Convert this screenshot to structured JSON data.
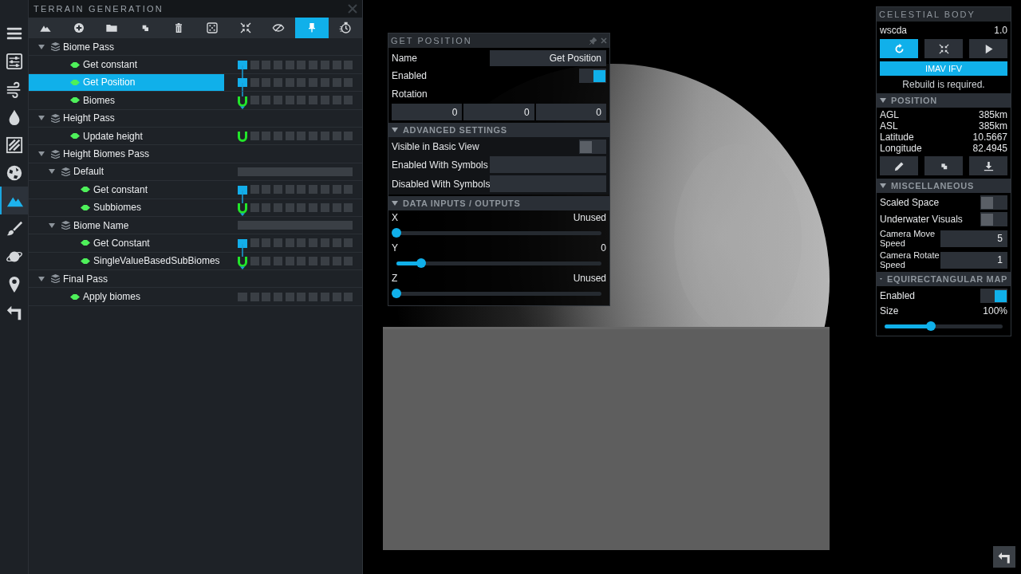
{
  "left_rail": [
    {
      "selected": false
    },
    {
      "selected": false
    },
    {
      "selected": false
    },
    {
      "selected": false
    },
    {
      "selected": false
    },
    {
      "selected": false
    },
    {
      "selected": true
    },
    {
      "selected": false
    },
    {
      "selected": false
    },
    {
      "selected": false
    },
    {
      "selected": false
    }
  ],
  "terrain_panel": {
    "title": "TERRAIN GENERATION",
    "toolbar": [
      {
        "selected": false
      },
      {
        "selected": false
      },
      {
        "selected": false
      },
      {
        "selected": false
      },
      {
        "selected": false
      },
      {
        "selected": false
      },
      {
        "selected": false
      },
      {
        "selected": false
      },
      {
        "selected": true
      },
      {
        "selected": false
      }
    ],
    "tree": [
      {
        "kind": "group",
        "label": "Biome Pass",
        "expanded": true,
        "lane_bar": false,
        "children": [
          {
            "kind": "node",
            "label": "Get constant",
            "selected": false,
            "output_port": true,
            "input_port": false,
            "link_in": false,
            "link_out": true
          },
          {
            "kind": "node",
            "label": "Get Position",
            "selected": true,
            "output_port": true,
            "input_port": false,
            "link_in": true,
            "link_out": true
          },
          {
            "kind": "node",
            "label": "Biomes",
            "selected": false,
            "output_port": false,
            "input_port": true,
            "link_in": true,
            "link_out": false
          }
        ]
      },
      {
        "kind": "group",
        "label": "Height Pass",
        "expanded": true,
        "lane_bar": false,
        "children": [
          {
            "kind": "node",
            "label": "Update height",
            "selected": false,
            "output_port": false,
            "input_port": true,
            "link_in": false,
            "link_out": false
          }
        ]
      },
      {
        "kind": "group",
        "label": "Height Biomes Pass",
        "expanded": true,
        "lane_bar": false,
        "children": [
          {
            "kind": "group",
            "label": "Default",
            "expanded": true,
            "lane_bar": true,
            "children": [
              {
                "kind": "node",
                "label": "Get constant",
                "selected": false,
                "output_port": true,
                "input_port": false,
                "link_in": false,
                "link_out": true
              },
              {
                "kind": "node",
                "label": "Subbiomes",
                "selected": false,
                "output_port": false,
                "input_port": true,
                "link_in": true,
                "link_out": false
              }
            ]
          },
          {
            "kind": "group",
            "label": "Biome Name",
            "expanded": true,
            "lane_bar": true,
            "children": [
              {
                "kind": "node",
                "label": "Get Constant",
                "selected": false,
                "output_port": true,
                "input_port": false,
                "link_in": false,
                "link_out": true
              },
              {
                "kind": "node",
                "label": "SingleValueBasedSubBiomes",
                "selected": false,
                "output_port": false,
                "input_port": true,
                "link_in": true,
                "link_out": false
              }
            ]
          }
        ]
      },
      {
        "kind": "group",
        "label": "Final Pass",
        "expanded": true,
        "lane_bar": false,
        "children": [
          {
            "kind": "node",
            "label": "Apply biomes",
            "selected": false,
            "output_port": false,
            "input_port": false,
            "link_in": false,
            "link_out": false
          }
        ]
      }
    ]
  },
  "get_position": {
    "title": "GET POSITION",
    "name_label": "Name",
    "name_value": "Get Position",
    "enabled_label": "Enabled",
    "enabled": true,
    "rotation_label": "Rotation",
    "rotation": [
      "0",
      "0",
      "0"
    ],
    "advanced": {
      "title": "ADVANCED SETTINGS",
      "expanded": true,
      "visible_label": "Visible in Basic View",
      "visible": false,
      "enabled_symbols_label": "Enabled With Symbols",
      "disabled_symbols_label": "Disabled With Symbols"
    },
    "data_io": {
      "title": "DATA INPUTS / OUTPUTS",
      "expanded": true,
      "sliders": [
        {
          "label": "X",
          "reading": "Unused",
          "level": 0
        },
        {
          "label": "Y",
          "reading": "0",
          "level": 0.12
        },
        {
          "label": "Z",
          "reading": "Unused",
          "level": 0
        }
      ]
    }
  },
  "celestial_body": {
    "title": "CELESTIAL BODY",
    "name": "wscda",
    "version": "1.0",
    "actions": [
      {
        "selected": true
      },
      {
        "selected": false
      },
      {
        "selected": false
      }
    ],
    "build_button": "IMAV IFV",
    "message": "Rebuild is required.",
    "position": {
      "title": "POSITION",
      "expanded": true,
      "stats": [
        {
          "label": "AGL",
          "value": "385km"
        },
        {
          "label": "ASL",
          "value": "385km"
        },
        {
          "label": "Latitude",
          "value": "10.5667"
        },
        {
          "label": "Longitude",
          "value": "82.4945"
        }
      ]
    },
    "misc": {
      "title": "MISCELLANEOUS",
      "expanded": true,
      "rows": [
        {
          "kind": "toggle",
          "label": "Scaled Space",
          "on": false
        },
        {
          "kind": "toggle",
          "label": "Underwater Visuals",
          "on": false
        },
        {
          "kind": "number",
          "label": "Camera Move Speed",
          "value": "5"
        },
        {
          "kind": "number",
          "label": "Camera Rotate Speed",
          "value": "1"
        }
      ]
    },
    "map": {
      "title": "EQUIRECTANGULAR MAP",
      "expanded": true,
      "enabled_label": "Enabled",
      "enabled": true,
      "size_label": "Size",
      "size_reading": "100%",
      "level": 0.39
    }
  }
}
